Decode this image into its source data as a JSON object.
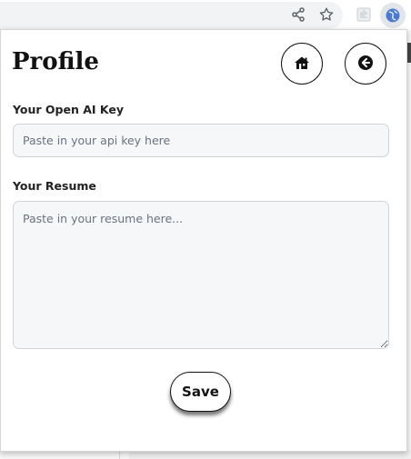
{
  "browser": {
    "share_icon": "share-icon",
    "bookmark_icon": "star-icon",
    "extension_icon": "puzzle-extension-icon",
    "active_extension_icon": "globe-extension-icon"
  },
  "popup": {
    "title": "Profile",
    "home_button_icon": "house-icon",
    "back_button_icon": "arrow-left-circle-icon",
    "api_key": {
      "label": "Your Open AI Key",
      "placeholder": "Paste in your api key here",
      "value": ""
    },
    "resume": {
      "label": "Your Resume",
      "placeholder": "Paste in your resume here...",
      "value": ""
    },
    "save_label": "Save"
  },
  "colors": {
    "text": "#111111",
    "field_bg": "#f6f7f9",
    "field_border": "#cfd4da"
  }
}
